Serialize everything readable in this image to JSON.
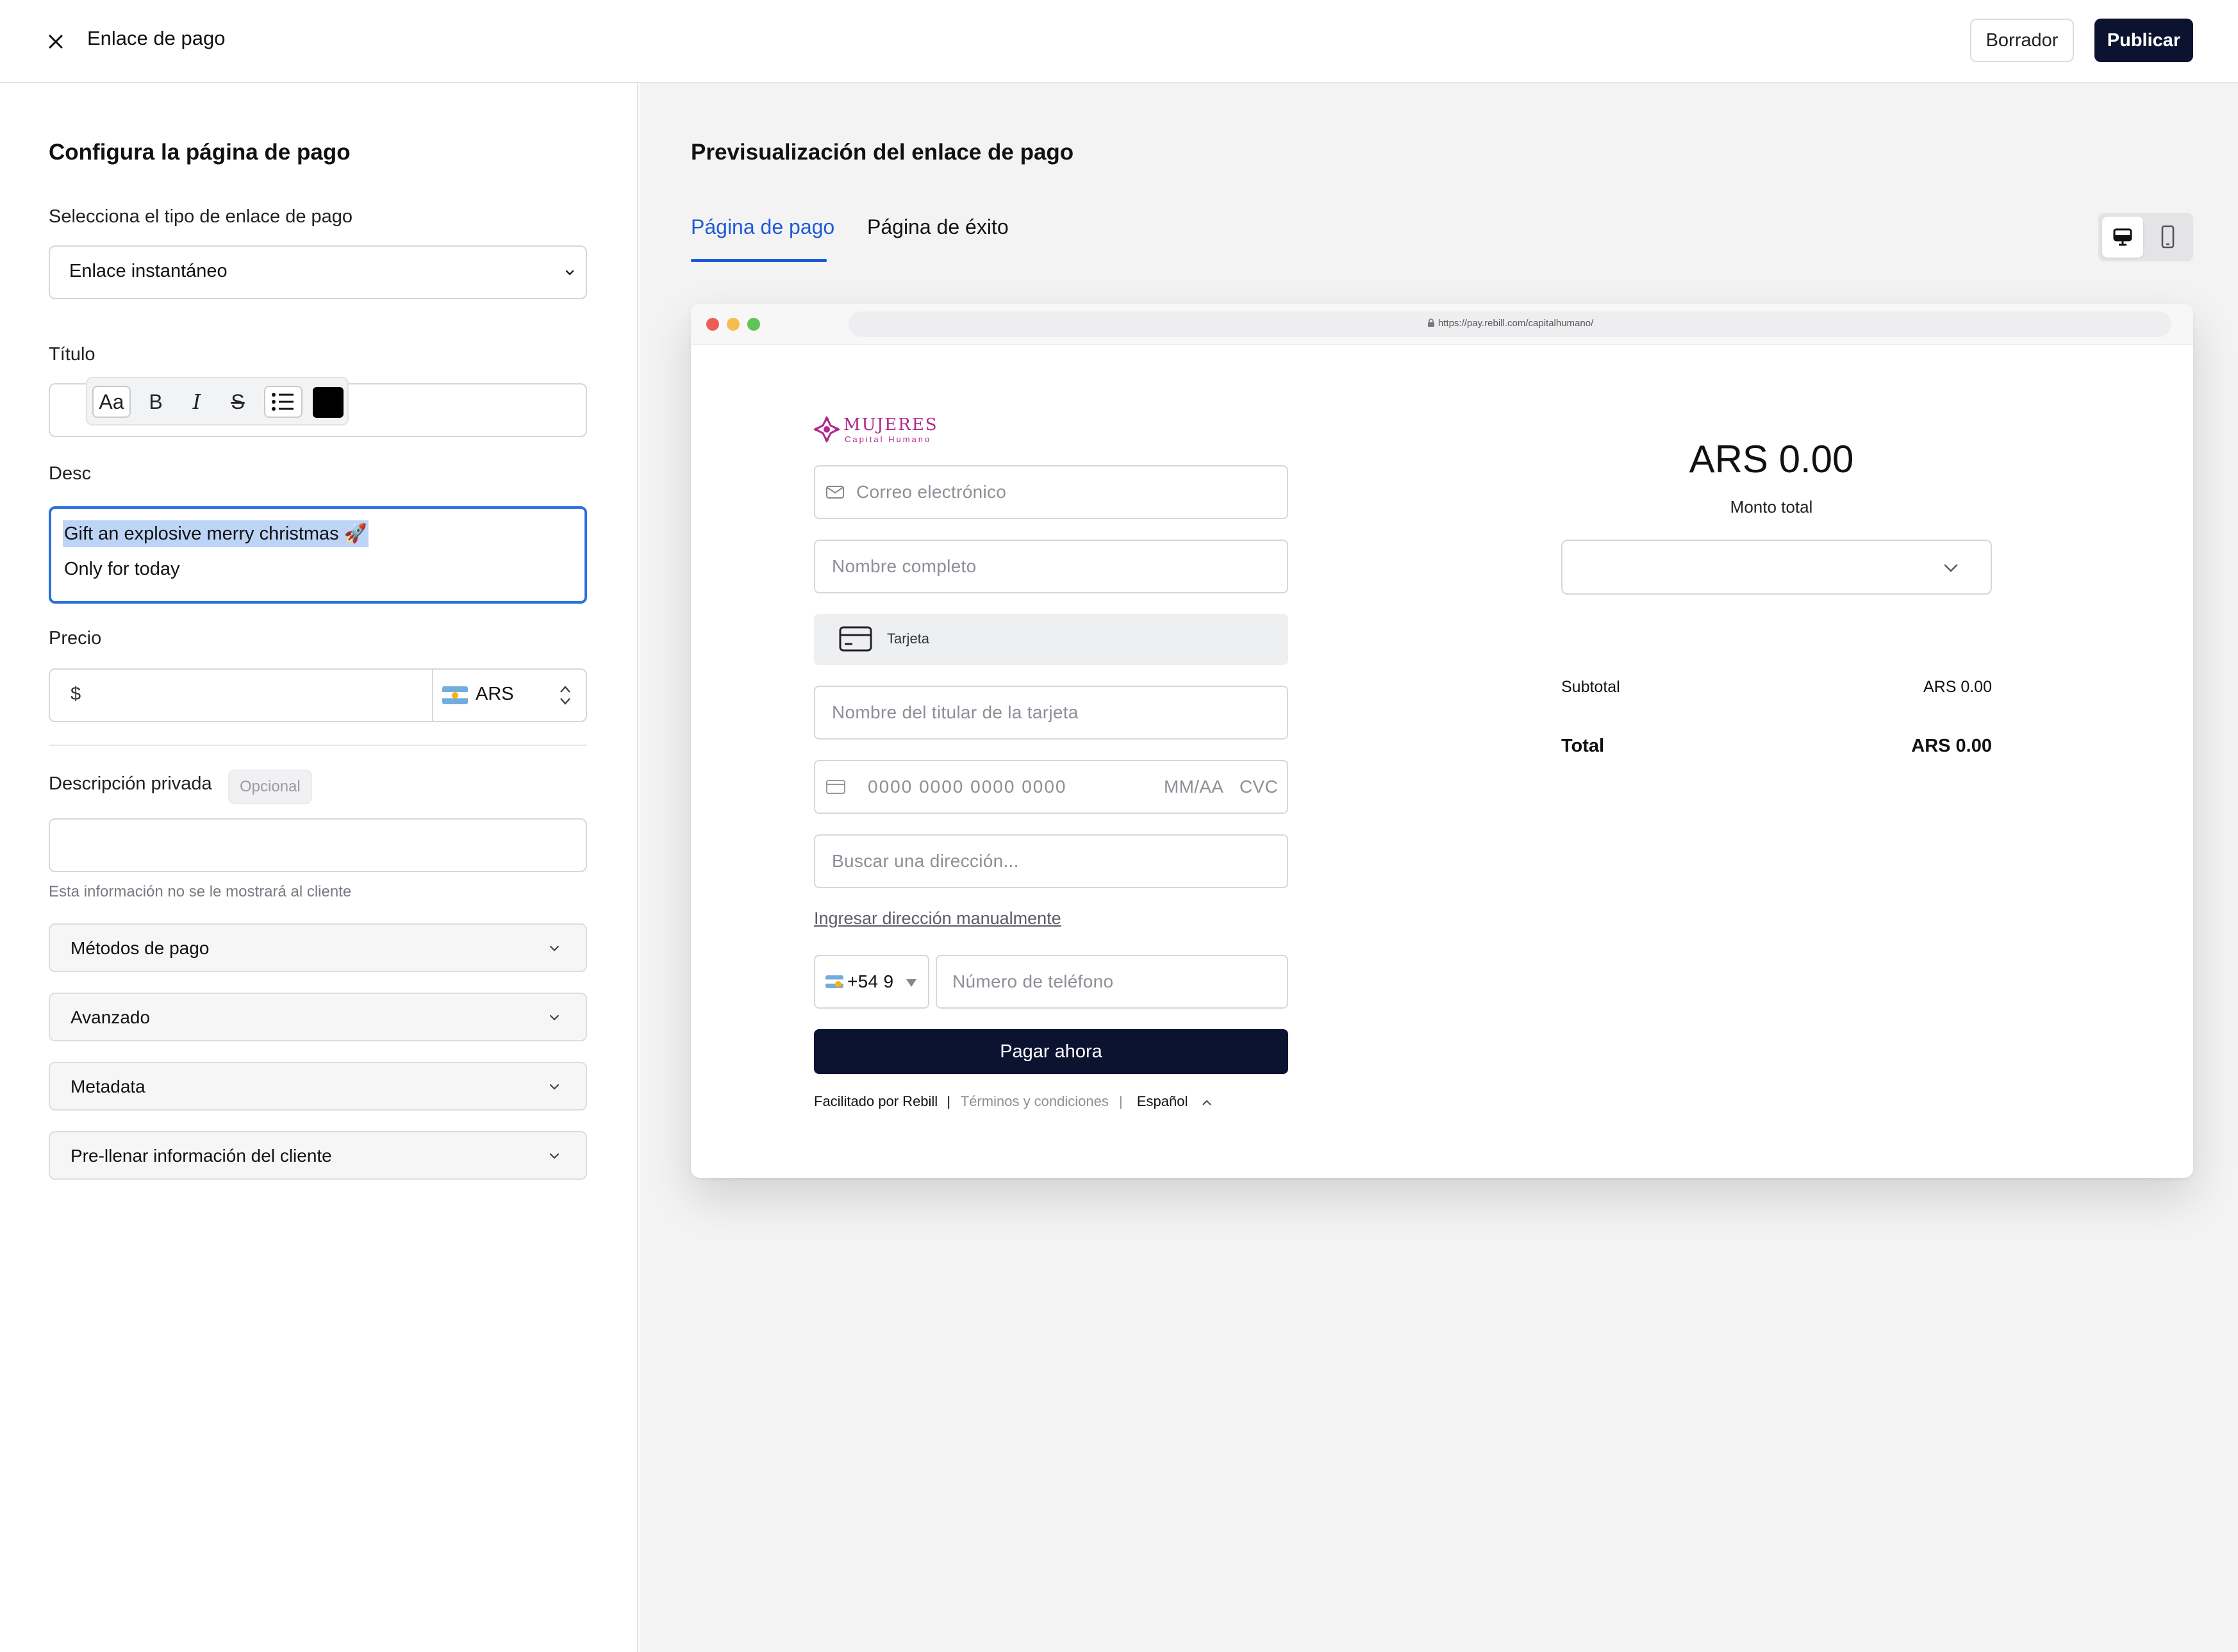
{
  "topbar": {
    "title": "Enlace de pago",
    "draft_label": "Borrador",
    "publish_label": "Publicar"
  },
  "config": {
    "heading": "Configura la página de pago",
    "type_label": "Selecciona el tipo de enlace de pago",
    "type_value": "Enlace instantáneo",
    "title_label": "Título",
    "title_value": "",
    "description_label": "Descripción",
    "description_label_visible": "Desc",
    "toolbar": {
      "aa": "Aa",
      "bold": "B",
      "italic": "I",
      "strike": "S"
    },
    "description_line1": "Gift an explosive merry christmas 🚀",
    "description_line2": "Only for today",
    "price_label": "Precio",
    "price_symbol": "$",
    "price_value": "",
    "currency": "ARS",
    "private_desc_label": "Descripción privada",
    "optional_badge": "Opcional",
    "private_desc_value": "",
    "private_help": "Esta información no se le mostrará al cliente",
    "accordions": [
      "Métodos de pago",
      "Avanzado",
      "Metadata",
      "Pre-llenar información del cliente"
    ]
  },
  "preview": {
    "heading": "Previsualización del enlace de pago",
    "tabs": [
      "Página de pago",
      "Página de éxito"
    ],
    "active_tab": "Página de pago",
    "url": "https://pay.rebill.com/capitalhumano/",
    "logo_name": "MUJERES",
    "logo_tagline": "Capital Humano",
    "form": {
      "email_ph": "Correo electrónico",
      "name_ph": "Nombre completo",
      "card_tab_label": "Tarjeta",
      "cardholder_ph": "Nombre del titular de la tarjeta",
      "card_number_ph": "0000 0000 0000 0000",
      "expiry_ph": "MM/AA",
      "cvc_ph": "CVC",
      "address_ph": "Buscar una dirección...",
      "manual_address": "Ingresar dirección manualmente",
      "phone_prefix": "+54 9",
      "phone_ph": "Número de teléfono",
      "pay_button": "Pagar ahora"
    },
    "footer": {
      "powered": "Facilitado por Rebill",
      "terms": "Términos y condiciones",
      "language": "Español",
      "separator": "|"
    },
    "summary": {
      "amount": "ARS 0.00",
      "amount_label": "Monto total",
      "subtotal_label": "Subtotal",
      "subtotal_value": "ARS 0.00",
      "total_label": "Total",
      "total_value": "ARS 0.00"
    }
  },
  "colors": {
    "primary_dark": "#0b1330",
    "accent_blue": "#1e5bd6",
    "logo_magenta": "#b0278c",
    "selection": "#bcd4f6"
  }
}
